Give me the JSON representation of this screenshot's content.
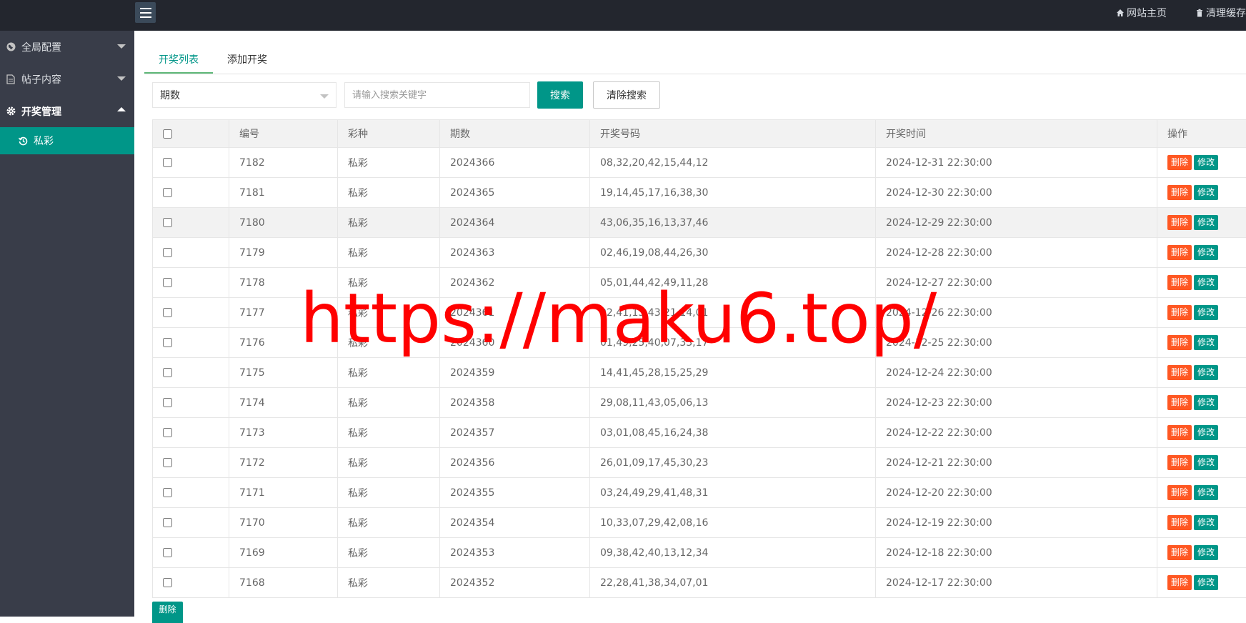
{
  "topbar": {
    "links": [
      {
        "label": "网站主页",
        "icon": "home-icon"
      },
      {
        "label": "清理缓存",
        "icon": "trash-icon"
      }
    ]
  },
  "sidebar": {
    "items": [
      {
        "label": "全局配置",
        "icon": "globe-icon",
        "open": false
      },
      {
        "label": "帖子内容",
        "icon": "document-icon",
        "open": false
      },
      {
        "label": "开奖管理",
        "icon": "gear-icon",
        "open": true
      }
    ],
    "sub_item": {
      "label": "私彩",
      "icon": "history-icon"
    }
  },
  "tabs": [
    {
      "label": "开奖列表",
      "active": true
    },
    {
      "label": "添加开奖",
      "active": false
    }
  ],
  "search": {
    "select_value": "期数",
    "placeholder": "请输入搜索关键字",
    "search_label": "搜索",
    "clear_label": "清除搜索"
  },
  "table": {
    "headers": [
      "编号",
      "彩种",
      "期数",
      "开奖号码",
      "开奖时间",
      "操作"
    ],
    "delete_label": "删除",
    "edit_label": "修改",
    "rows": [
      {
        "id": "7182",
        "type": "私彩",
        "period": "2024366",
        "numbers": "08,32,20,42,15,44,12",
        "time": "2024-12-31 22:30:00"
      },
      {
        "id": "7181",
        "type": "私彩",
        "period": "2024365",
        "numbers": "19,14,45,17,16,38,30",
        "time": "2024-12-30 22:30:00"
      },
      {
        "id": "7180",
        "type": "私彩",
        "period": "2024364",
        "numbers": "43,06,35,16,13,37,46",
        "time": "2024-12-29 22:30:00"
      },
      {
        "id": "7179",
        "type": "私彩",
        "period": "2024363",
        "numbers": "02,46,19,08,44,26,30",
        "time": "2024-12-28 22:30:00"
      },
      {
        "id": "7178",
        "type": "私彩",
        "period": "2024362",
        "numbers": "05,01,44,42,49,11,28",
        "time": "2024-12-27 22:30:00"
      },
      {
        "id": "7177",
        "type": "私彩",
        "period": "2024361",
        "numbers": "02,41,13,43,21,14,01",
        "time": "2024-12-26 22:30:00"
      },
      {
        "id": "7176",
        "type": "私彩",
        "period": "2024360",
        "numbers": "01,49,25,40,07,33,17",
        "time": "2024-12-25 22:30:00"
      },
      {
        "id": "7175",
        "type": "私彩",
        "period": "2024359",
        "numbers": "14,41,45,28,15,25,29",
        "time": "2024-12-24 22:30:00"
      },
      {
        "id": "7174",
        "type": "私彩",
        "period": "2024358",
        "numbers": "29,08,11,43,05,06,13",
        "time": "2024-12-23 22:30:00"
      },
      {
        "id": "7173",
        "type": "私彩",
        "period": "2024357",
        "numbers": "03,01,08,45,16,24,38",
        "time": "2024-12-22 22:30:00"
      },
      {
        "id": "7172",
        "type": "私彩",
        "period": "2024356",
        "numbers": "26,01,09,17,45,30,23",
        "time": "2024-12-21 22:30:00"
      },
      {
        "id": "7171",
        "type": "私彩",
        "period": "2024355",
        "numbers": "03,24,49,29,41,48,31",
        "time": "2024-12-20 22:30:00"
      },
      {
        "id": "7170",
        "type": "私彩",
        "period": "2024354",
        "numbers": "10,33,07,29,42,08,16",
        "time": "2024-12-19 22:30:00"
      },
      {
        "id": "7169",
        "type": "私彩",
        "period": "2024353",
        "numbers": "09,38,42,40,13,12,34",
        "time": "2024-12-18 22:30:00"
      },
      {
        "id": "7168",
        "type": "私彩",
        "period": "2024352",
        "numbers": "22,28,41,38,34,07,01",
        "time": "2024-12-17 22:30:00"
      }
    ]
  },
  "bottom": {
    "delete_label": "删除"
  },
  "watermark": "https://maku6.top/",
  "colors": {
    "accent": "#009688",
    "danger": "#ff5722",
    "sidebar": "#393d49",
    "topbar": "#23262e"
  }
}
